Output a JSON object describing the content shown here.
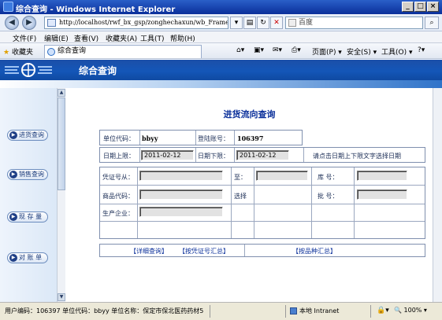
{
  "window": {
    "title": "综合查询 - Windows Internet Explorer",
    "minimize": "_",
    "maximize": "□",
    "close": "×"
  },
  "address": {
    "url": "http://localhost/rwf_bx_gsp/zonghechaxun/wb_Frameset_",
    "search_placeholder": "百度",
    "back_glyph": "◀",
    "forward_glyph": "▶"
  },
  "menu": [
    "文件(F)",
    "编辑(E)",
    "查看(V)",
    "收藏夹(A)",
    "工具(T)",
    "帮助(H)"
  ],
  "favbar": {
    "favorites_label": "收藏夹",
    "tab_title": "综合查询",
    "tools": [
      "页面(P) ▾",
      "安全(S) ▾",
      "工具(O) ▾"
    ]
  },
  "app": {
    "title": "综合查询",
    "nav": [
      "进货查询",
      "销售查询",
      "现 存 量",
      "对 账 单"
    ]
  },
  "form": {
    "title": "进货流向查询",
    "unit_code_label": "单位代码：",
    "unit_code": "bbyy",
    "login_no_label": "登陆账号：",
    "login_no": "106397",
    "date_upper_label": "日期上限：",
    "date_upper": "2011-02-12",
    "date_lower_label": "日期下限：",
    "date_lower": "2011-02-12",
    "date_hint": "请点击日期上下限文字选择日期",
    "voucher_from_label": "凭证号从：",
    "voucher_to_label": "至：",
    "warehouse_label": "库    号：",
    "product_code_label": "商品代码：",
    "select_label": "选择",
    "batch_label": "批    号：",
    "manufacturer_label": "生产企业：",
    "detail_query": "【详细查询】",
    "summary_by_voucher": "【按凭证号汇总】",
    "summary_by_product": "【按品种汇总】"
  },
  "status": {
    "text": "用户编码：106397 单位代码：bbyy  单位名称：保定市保北医药药材5",
    "zone": "本地 Intranet",
    "zoom": "100%"
  }
}
